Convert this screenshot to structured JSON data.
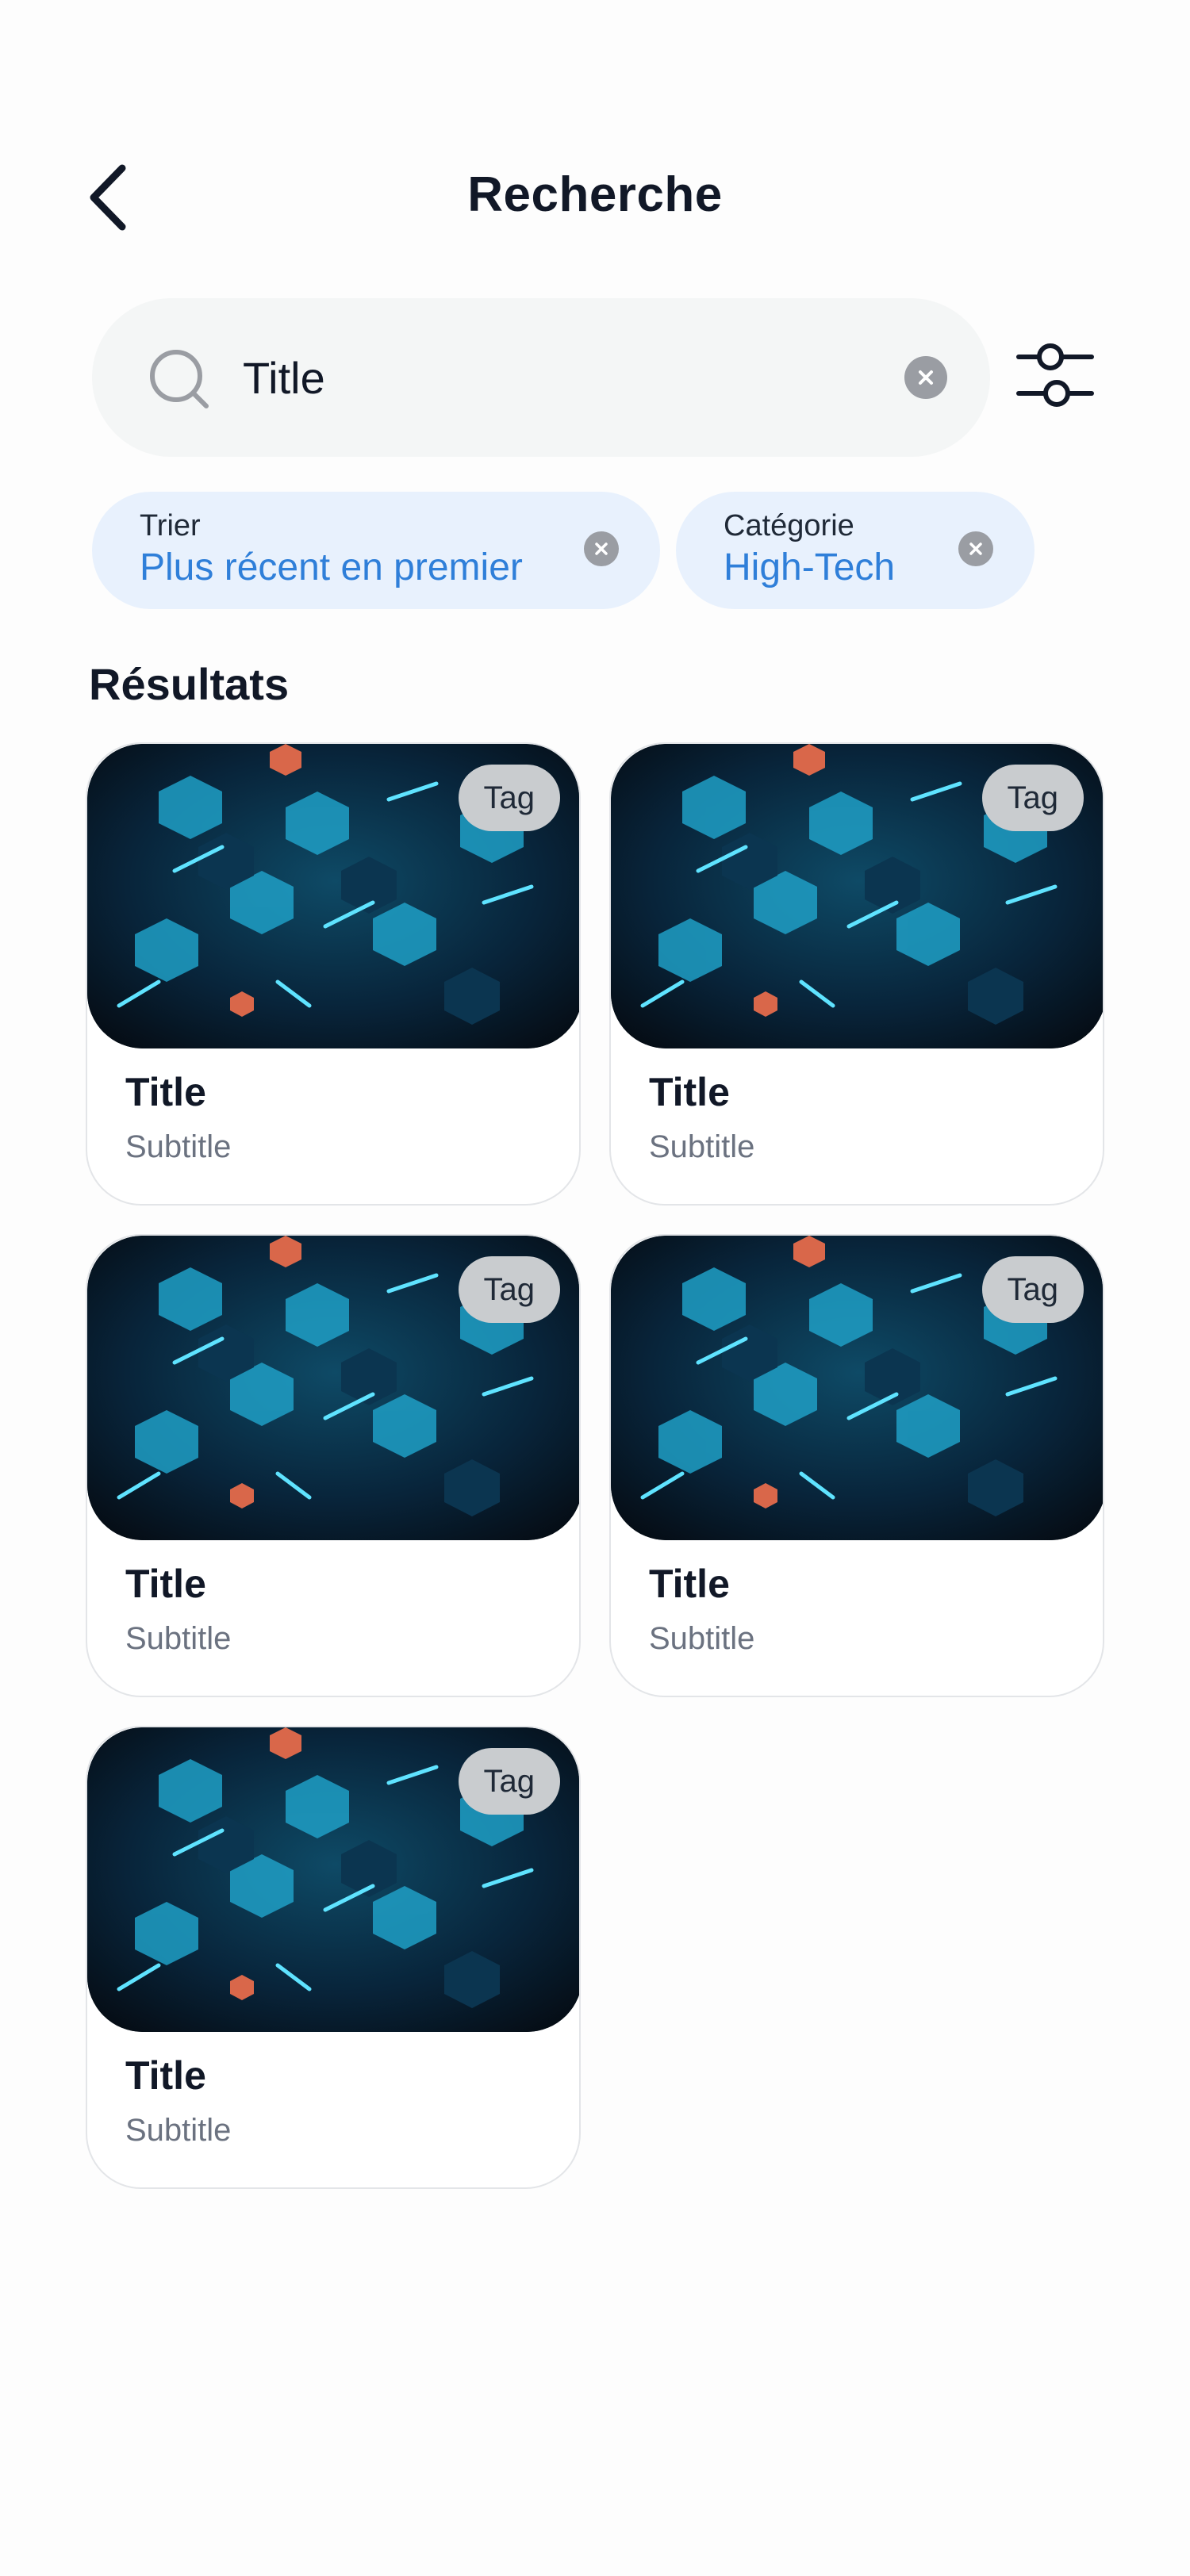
{
  "header": {
    "title": "Recherche"
  },
  "search": {
    "value": "Title",
    "placeholder": ""
  },
  "filters": [
    {
      "label": "Trier",
      "value": "Plus récent en premier"
    },
    {
      "label": "Catégorie",
      "value": "High-Tech"
    }
  ],
  "results": {
    "heading": "Résultats",
    "items": [
      {
        "tag": "Tag",
        "title": "Title",
        "subtitle": "Subtitle"
      },
      {
        "tag": "Tag",
        "title": "Title",
        "subtitle": "Subtitle"
      },
      {
        "tag": "Tag",
        "title": "Title",
        "subtitle": "Subtitle"
      },
      {
        "tag": "Tag",
        "title": "Title",
        "subtitle": "Subtitle"
      },
      {
        "tag": "Tag",
        "title": "Title",
        "subtitle": "Subtitle"
      }
    ]
  },
  "icons": {
    "back": "chevron-left-icon",
    "search": "search-icon",
    "clear": "close-circle-icon",
    "filter": "sliders-icon"
  },
  "colors": {
    "accent": "#2f7fd9",
    "chip_background": "#e8f1fd",
    "search_background": "#f4f6f6",
    "tag_background": "#c9cccf"
  }
}
